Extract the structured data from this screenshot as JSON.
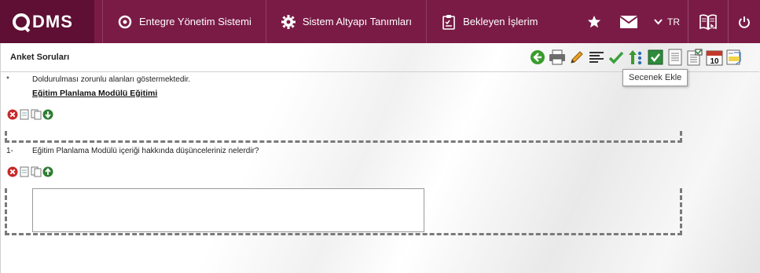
{
  "brand": {
    "name": "DMS"
  },
  "nav": {
    "items": [
      {
        "label": "Entegre Yönetim Sistemi",
        "icon": "q-logo-icon"
      },
      {
        "label": "Sistem Altyapı Tanımları",
        "icon": "gear-icon"
      },
      {
        "label": "Bekleyen İşlerim",
        "icon": "clipboard-icon"
      }
    ],
    "language": "TR",
    "icons": [
      "star-icon",
      "mail-icon",
      "chevron-down-icon",
      "book-icon",
      "power-icon"
    ]
  },
  "page": {
    "title": "Anket Soruları",
    "tooltip": "Secenek Ekle"
  },
  "toolbar": {
    "icons": [
      "back-icon",
      "print-icon",
      "edit-icon",
      "align-icon",
      "check-icon",
      "up-arrow-icon",
      "checkbox-icon",
      "document-icon",
      "checklist-icon",
      "calendar-icon",
      "note-icon"
    ],
    "calendar_day": "10"
  },
  "survey": {
    "required_marker": "*",
    "required_note": "Doldurulması zorunlu alanları göstermektedir.",
    "section_title": "Eğitim Planlama Modülü Eğitimi",
    "question_number": "1-",
    "question_text": "Eğitim Planlama Modülü içeriği hakkında düşünceleriniz nelerdir?",
    "answer_value": ""
  },
  "colors": {
    "topbar": "#7a1b46",
    "logo_bg": "#5e0f33",
    "dashed_border": "#7a7a7a"
  }
}
